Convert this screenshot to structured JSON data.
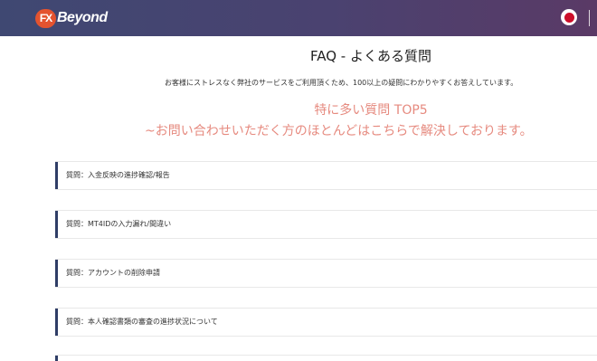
{
  "header": {
    "logo_mark": "FX",
    "logo_text": "Beyond",
    "language_flag": "japan-flag-icon"
  },
  "faq": {
    "title": "FAQ - よくある質問",
    "description": "お客様にストレスなく弊社のサービスをご利用頂くため、100以上の疑問にわかりやすくお答えしています。"
  },
  "top5": {
    "title": "特に多い質問 TOP5",
    "subtitle": "~お問い合わせいただく方のほとんどはこちらで解決しております。"
  },
  "questions": [
    {
      "label": "質問：入金反映の進捗確認/報告"
    },
    {
      "label": "質問：MT4IDの入力漏れ/間違い"
    },
    {
      "label": "質問：アカウントの削除申請"
    },
    {
      "label": "質問：本人確認書類の審査の進捗状況について"
    }
  ],
  "colors": {
    "header_bg": "#434670",
    "accent_text": "#e68a7f",
    "item_bar": "#2f3d66",
    "logo_mark": "#e4532f"
  }
}
